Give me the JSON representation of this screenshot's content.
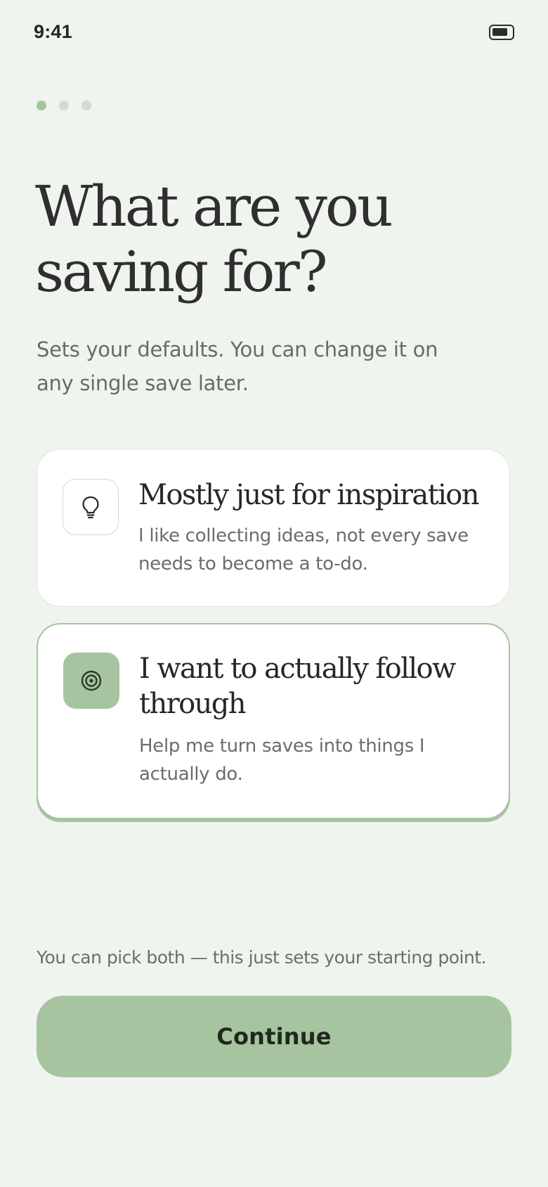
{
  "status_bar": {
    "time": "9:41",
    "battery_icon": "battery-icon"
  },
  "progress": {
    "total_steps": 3,
    "current_step": 1,
    "active_color": "#a6c49f",
    "inactive_color": "#d5d8d3"
  },
  "header": {
    "title": "What are you saving for?",
    "subtitle": "Sets your defaults. You can change it on any single save later."
  },
  "options": [
    {
      "icon": "lightbulb-icon",
      "title": "Mostly just for inspiration",
      "description": "I like collecting ideas, not every save needs to become a to-do.",
      "selected": false
    },
    {
      "icon": "target-icon",
      "title": "I want to actually follow through",
      "description": "Help me turn saves into things I actually do.",
      "selected": true
    }
  ],
  "footer": {
    "note": "You can pick both — this just sets your starting point.",
    "continue_label": "Continue"
  },
  "colors": {
    "background": "#f0f4ef",
    "accent": "#a6c49f",
    "card": "#ffffff",
    "text_primary": "#2f2f2f",
    "text_secondary": "#6a6a66"
  }
}
